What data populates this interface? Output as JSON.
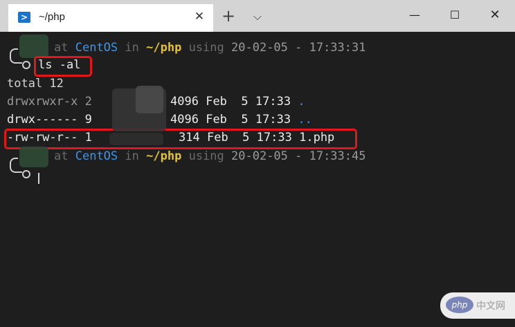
{
  "tab": {
    "title": "~/php",
    "icon": "powershell-icon"
  },
  "titlebar": {
    "new_tab": "+",
    "dropdown": "⌵",
    "minimize": "—",
    "maximize": "☐",
    "close": "✕"
  },
  "prompt1": {
    "at": "at",
    "host": "CentOS",
    "in": "in",
    "dir": "~/php",
    "using": "using",
    "time": "20-02-05 - 17:33:31",
    "command": "ls -al"
  },
  "output": {
    "total": "total 12",
    "rows": [
      {
        "perm": "drwxrwxr-x",
        "links": "2",
        "size": "4096",
        "month": "Feb",
        "day": "5",
        "time": "17:33",
        "name": "."
      },
      {
        "perm": "drwx------",
        "links": "9",
        "size": "4096",
        "month": "Feb",
        "day": "5",
        "time": "17:33",
        "name": ".."
      },
      {
        "perm": "-rw-rw-r--",
        "links": "1",
        "size": "314",
        "month": "Feb",
        "day": "5",
        "time": "17:33",
        "name": "1.php"
      }
    ]
  },
  "prompt2": {
    "at": "at",
    "host": "CentOS",
    "in": "in",
    "dir": "~/php",
    "using": "using",
    "time": "20-02-05 - 17:33:45"
  },
  "watermark": {
    "logo": "php",
    "text": "中文网"
  },
  "colors": {
    "highlight_border": "#e21818",
    "host": "#3d95e8",
    "dir": "#e5c22f"
  }
}
